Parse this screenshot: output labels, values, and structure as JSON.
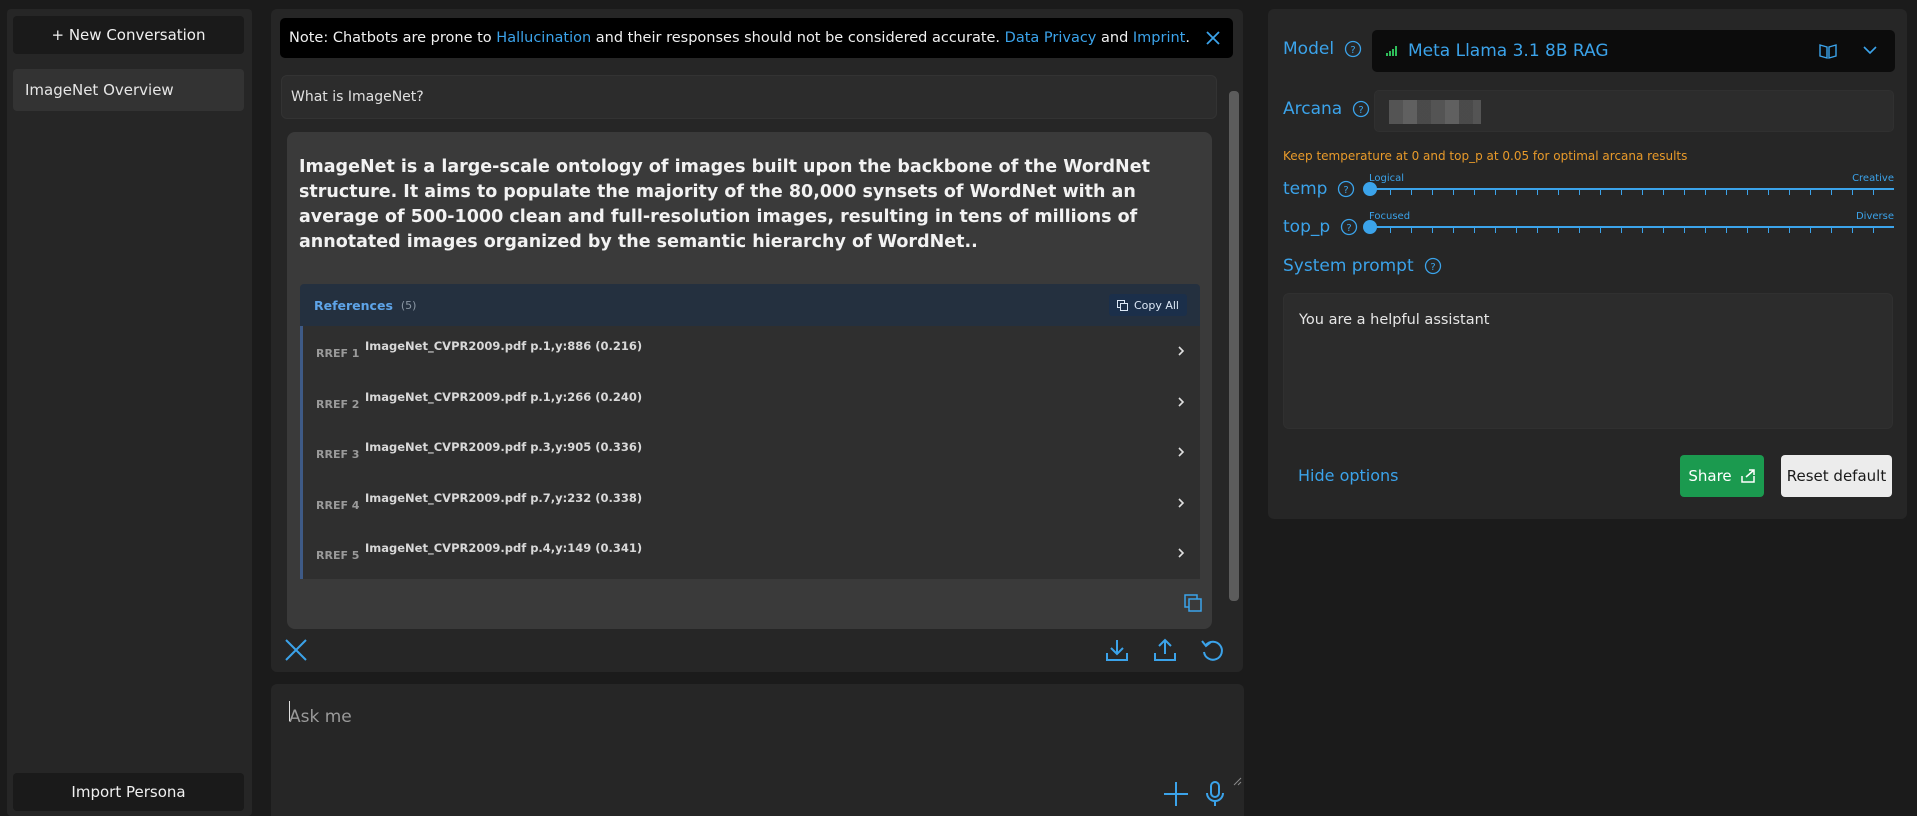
{
  "sidebar": {
    "new_conversation": "+ New Conversation",
    "conversations": [
      "ImageNet Overview"
    ],
    "import_persona": "Import Persona"
  },
  "notice": {
    "prefix": "Note: Chatbots are prone to ",
    "hallucination": "Hallucination",
    "middle": " and their responses should not be considered accurate. ",
    "privacy": "Data Privacy",
    "and": " and ",
    "imprint": "Imprint",
    "end": "."
  },
  "chat": {
    "question": "What is ImageNet?",
    "answer": "ImageNet is a large-scale ontology of images built upon the backbone of the WordNet structure. It aims to populate the majority of the 80,000 synsets of WordNet with an average of 500-1000 clean and full-resolution images, resulting in tens of millions of annotated images organized by the semantic hierarchy of WordNet..",
    "references": {
      "title": "References",
      "count": "(5)",
      "copy_all": "Copy All",
      "items": [
        {
          "label": "RREF 1",
          "file": "ImageNet_CVPR2009.pdf p.1,y:886 (0.216)"
        },
        {
          "label": "RREF 2",
          "file": "ImageNet_CVPR2009.pdf p.1,y:266 (0.240)"
        },
        {
          "label": "RREF 3",
          "file": "ImageNet_CVPR2009.pdf p.3,y:905 (0.336)"
        },
        {
          "label": "RREF 4",
          "file": "ImageNet_CVPR2009.pdf p.7,y:232 (0.338)"
        },
        {
          "label": "RREF 5",
          "file": "ImageNet_CVPR2009.pdf p.4,y:149 (0.341)"
        }
      ]
    }
  },
  "input": {
    "placeholder": "Ask me"
  },
  "options": {
    "model_label": "Model",
    "model_value": "Meta Llama 3.1 8B RAG",
    "arcana_label": "Arcana",
    "hint": "Keep temperature at 0 and top_p at 0.05 for optimal arcana results",
    "temp": {
      "label": "temp",
      "min_label": "Logical",
      "max_label": "Creative",
      "value": 0
    },
    "top_p": {
      "label": "top_p",
      "min_label": "Focused",
      "max_label": "Diverse",
      "value": 0
    },
    "system_prompt_label": "System prompt",
    "system_prompt": "You are a helpful assistant",
    "hide_options": "Hide options",
    "share": "Share",
    "reset": "Reset default"
  },
  "colors": {
    "accent": "#3ba3ea",
    "share_green": "#1b9a4f",
    "warning_orange": "#e89a2a"
  }
}
